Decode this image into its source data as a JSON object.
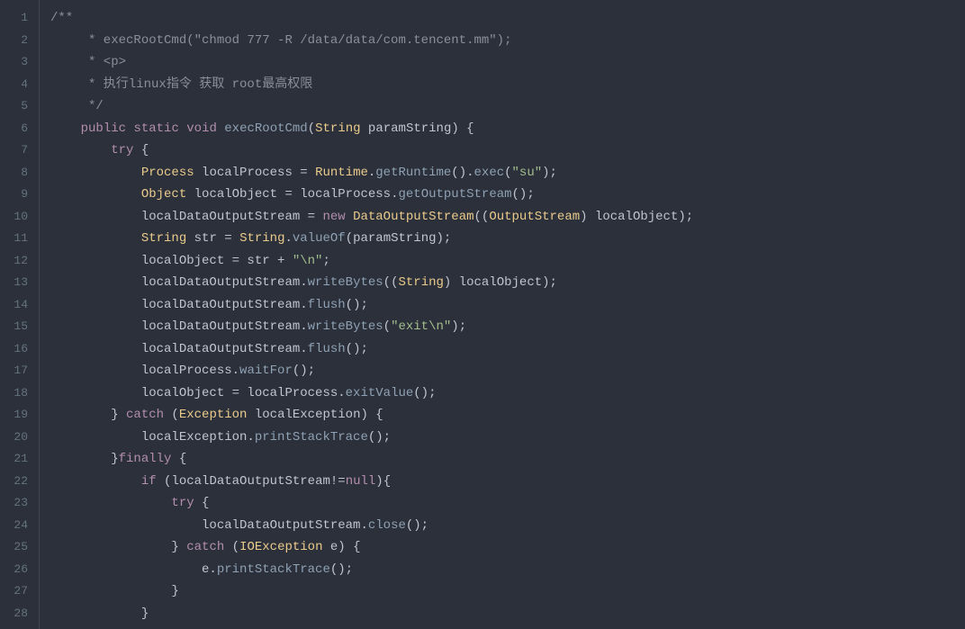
{
  "editor": {
    "lines": [
      {
        "no": 1,
        "segments": [
          {
            "cls": "c-comment",
            "text": "/**"
          }
        ]
      },
      {
        "no": 2,
        "segments": [
          {
            "cls": "c-comment",
            "text": "     * execRootCmd(\"chmod 777 -R /data/data/com.tencent.mm\");"
          }
        ]
      },
      {
        "no": 3,
        "segments": [
          {
            "cls": "c-comment",
            "text": "     * <p>"
          }
        ]
      },
      {
        "no": 4,
        "segments": [
          {
            "cls": "c-comment",
            "text": "     * 执行linux指令 获取 root最高权限"
          }
        ]
      },
      {
        "no": 5,
        "segments": [
          {
            "cls": "c-comment",
            "text": "     */"
          }
        ]
      },
      {
        "no": 6,
        "segments": [
          {
            "cls": "c-punct",
            "text": "    "
          },
          {
            "cls": "c-keyword",
            "text": "public"
          },
          {
            "cls": "c-punct",
            "text": " "
          },
          {
            "cls": "c-keyword",
            "text": "static"
          },
          {
            "cls": "c-punct",
            "text": " "
          },
          {
            "cls": "c-keyword",
            "text": "void"
          },
          {
            "cls": "c-punct",
            "text": " "
          },
          {
            "cls": "c-method",
            "text": "execRootCmd"
          },
          {
            "cls": "c-punct",
            "text": "("
          },
          {
            "cls": "c-type",
            "text": "String"
          },
          {
            "cls": "c-punct",
            "text": " paramString) {"
          }
        ]
      },
      {
        "no": 7,
        "segments": [
          {
            "cls": "c-punct",
            "text": "        "
          },
          {
            "cls": "c-keyword",
            "text": "try"
          },
          {
            "cls": "c-punct",
            "text": " {"
          }
        ]
      },
      {
        "no": 8,
        "segments": [
          {
            "cls": "c-punct",
            "text": "            "
          },
          {
            "cls": "c-type",
            "text": "Process"
          },
          {
            "cls": "c-punct",
            "text": " localProcess = "
          },
          {
            "cls": "c-type",
            "text": "Runtime"
          },
          {
            "cls": "c-punct",
            "text": "."
          },
          {
            "cls": "c-method",
            "text": "getRuntime"
          },
          {
            "cls": "c-punct",
            "text": "()."
          },
          {
            "cls": "c-method",
            "text": "exec"
          },
          {
            "cls": "c-punct",
            "text": "("
          },
          {
            "cls": "c-string",
            "text": "\"su\""
          },
          {
            "cls": "c-punct",
            "text": ");"
          }
        ]
      },
      {
        "no": 9,
        "segments": [
          {
            "cls": "c-punct",
            "text": "            "
          },
          {
            "cls": "c-type",
            "text": "Object"
          },
          {
            "cls": "c-punct",
            "text": " localObject = localProcess."
          },
          {
            "cls": "c-method",
            "text": "getOutputStream"
          },
          {
            "cls": "c-punct",
            "text": "();"
          }
        ]
      },
      {
        "no": 10,
        "segments": [
          {
            "cls": "c-punct",
            "text": "            localDataOutputStream = "
          },
          {
            "cls": "c-keyword",
            "text": "new"
          },
          {
            "cls": "c-punct",
            "text": " "
          },
          {
            "cls": "c-type",
            "text": "DataOutputStream"
          },
          {
            "cls": "c-punct",
            "text": "(("
          },
          {
            "cls": "c-type",
            "text": "OutputStream"
          },
          {
            "cls": "c-punct",
            "text": ") localObject);"
          }
        ]
      },
      {
        "no": 11,
        "segments": [
          {
            "cls": "c-punct",
            "text": "            "
          },
          {
            "cls": "c-type",
            "text": "String"
          },
          {
            "cls": "c-punct",
            "text": " str = "
          },
          {
            "cls": "c-type",
            "text": "String"
          },
          {
            "cls": "c-punct",
            "text": "."
          },
          {
            "cls": "c-method",
            "text": "valueOf"
          },
          {
            "cls": "c-punct",
            "text": "(paramString);"
          }
        ]
      },
      {
        "no": 12,
        "segments": [
          {
            "cls": "c-punct",
            "text": "            localObject = str + "
          },
          {
            "cls": "c-string",
            "text": "\"\\n\""
          },
          {
            "cls": "c-punct",
            "text": ";"
          }
        ]
      },
      {
        "no": 13,
        "segments": [
          {
            "cls": "c-punct",
            "text": "            localDataOutputStream."
          },
          {
            "cls": "c-method",
            "text": "writeBytes"
          },
          {
            "cls": "c-punct",
            "text": "(("
          },
          {
            "cls": "c-type",
            "text": "String"
          },
          {
            "cls": "c-punct",
            "text": ") localObject);"
          }
        ]
      },
      {
        "no": 14,
        "segments": [
          {
            "cls": "c-punct",
            "text": "            localDataOutputStream."
          },
          {
            "cls": "c-method",
            "text": "flush"
          },
          {
            "cls": "c-punct",
            "text": "();"
          }
        ]
      },
      {
        "no": 15,
        "segments": [
          {
            "cls": "c-punct",
            "text": "            localDataOutputStream."
          },
          {
            "cls": "c-method",
            "text": "writeBytes"
          },
          {
            "cls": "c-punct",
            "text": "("
          },
          {
            "cls": "c-string",
            "text": "\"exit\\n\""
          },
          {
            "cls": "c-punct",
            "text": ");"
          }
        ]
      },
      {
        "no": 16,
        "segments": [
          {
            "cls": "c-punct",
            "text": "            localDataOutputStream."
          },
          {
            "cls": "c-method",
            "text": "flush"
          },
          {
            "cls": "c-punct",
            "text": "();"
          }
        ]
      },
      {
        "no": 17,
        "segments": [
          {
            "cls": "c-punct",
            "text": "            localProcess."
          },
          {
            "cls": "c-method",
            "text": "waitFor"
          },
          {
            "cls": "c-punct",
            "text": "();"
          }
        ]
      },
      {
        "no": 18,
        "segments": [
          {
            "cls": "c-punct",
            "text": "            localObject = localProcess."
          },
          {
            "cls": "c-method",
            "text": "exitValue"
          },
          {
            "cls": "c-punct",
            "text": "();"
          }
        ]
      },
      {
        "no": 19,
        "segments": [
          {
            "cls": "c-punct",
            "text": "        } "
          },
          {
            "cls": "c-keyword",
            "text": "catch"
          },
          {
            "cls": "c-punct",
            "text": " ("
          },
          {
            "cls": "c-type",
            "text": "Exception"
          },
          {
            "cls": "c-punct",
            "text": " localException) {"
          }
        ]
      },
      {
        "no": 20,
        "segments": [
          {
            "cls": "c-punct",
            "text": "            localException."
          },
          {
            "cls": "c-method",
            "text": "printStackTrace"
          },
          {
            "cls": "c-punct",
            "text": "();"
          }
        ]
      },
      {
        "no": 21,
        "segments": [
          {
            "cls": "c-punct",
            "text": "        }"
          },
          {
            "cls": "c-keyword",
            "text": "finally"
          },
          {
            "cls": "c-punct",
            "text": " {"
          }
        ]
      },
      {
        "no": 22,
        "segments": [
          {
            "cls": "c-punct",
            "text": "            "
          },
          {
            "cls": "c-keyword",
            "text": "if"
          },
          {
            "cls": "c-punct",
            "text": " (localDataOutputStream!="
          },
          {
            "cls": "c-keyword",
            "text": "null"
          },
          {
            "cls": "c-punct",
            "text": "){"
          }
        ]
      },
      {
        "no": 23,
        "segments": [
          {
            "cls": "c-punct",
            "text": "                "
          },
          {
            "cls": "c-keyword",
            "text": "try"
          },
          {
            "cls": "c-punct",
            "text": " {"
          }
        ]
      },
      {
        "no": 24,
        "segments": [
          {
            "cls": "c-punct",
            "text": "                    localDataOutputStream."
          },
          {
            "cls": "c-method",
            "text": "close"
          },
          {
            "cls": "c-punct",
            "text": "();"
          }
        ]
      },
      {
        "no": 25,
        "segments": [
          {
            "cls": "c-punct",
            "text": "                } "
          },
          {
            "cls": "c-keyword",
            "text": "catch"
          },
          {
            "cls": "c-punct",
            "text": " ("
          },
          {
            "cls": "c-type",
            "text": "IOException"
          },
          {
            "cls": "c-punct",
            "text": " e) {"
          }
        ]
      },
      {
        "no": 26,
        "segments": [
          {
            "cls": "c-punct",
            "text": "                    e."
          },
          {
            "cls": "c-method",
            "text": "printStackTrace"
          },
          {
            "cls": "c-punct",
            "text": "();"
          }
        ]
      },
      {
        "no": 27,
        "segments": [
          {
            "cls": "c-punct",
            "text": "                }"
          }
        ]
      },
      {
        "no": 28,
        "segments": [
          {
            "cls": "c-punct",
            "text": "            }"
          }
        ]
      }
    ]
  }
}
